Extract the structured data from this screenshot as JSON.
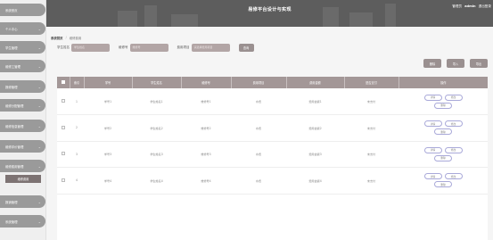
{
  "header": {
    "title": "易修平台设计与实现",
    "role": "管理员",
    "username": "admin",
    "logout": "退出登录"
  },
  "sidebar": {
    "items": [
      {
        "label": "系统首页"
      },
      {
        "label": "个人中心"
      },
      {
        "label": "学生管理"
      },
      {
        "label": "维修工管理"
      },
      {
        "label": "报修管理"
      },
      {
        "label": "维修分配管理"
      },
      {
        "label": "维修信息管理"
      },
      {
        "label": "维修评价管理"
      },
      {
        "label": "维修费用管理"
      },
      {
        "label": "报销管理"
      },
      {
        "label": "系统管理"
      }
    ],
    "active_sub": "维修费用"
  },
  "breadcrumb": {
    "home": "系统首页",
    "sep": "/",
    "current": "维修费用"
  },
  "search": {
    "fields": [
      {
        "label": "学生姓名",
        "placeholder": "学生姓名"
      },
      {
        "label": "维修号",
        "placeholder": "维修号"
      },
      {
        "label": "费用项目",
        "placeholder": "请选择费用项目"
      }
    ],
    "button": "查询"
  },
  "toolbar": {
    "delete": "删除",
    "import": "导入",
    "export": "导出"
  },
  "table": {
    "columns": [
      "",
      "索引",
      "学号",
      "学生姓名",
      "维修号",
      "费用项目",
      "费用金额",
      "是否支付",
      "操作"
    ],
    "rows": [
      {
        "index": "1",
        "student_no": "学号1",
        "name": "学生姓名1",
        "repair_no": "维修号1",
        "item": "水费",
        "amount": "费用金额1",
        "paid": "未支付"
      },
      {
        "index": "2",
        "student_no": "学号2",
        "name": "学生姓名2",
        "repair_no": "维修号2",
        "item": "水费",
        "amount": "费用金额2",
        "paid": "未支付"
      },
      {
        "index": "3",
        "student_no": "学号3",
        "name": "学生姓名3",
        "repair_no": "维修号3",
        "item": "水费",
        "amount": "费用金额3",
        "paid": "未支付"
      },
      {
        "index": "4",
        "student_no": "学号4",
        "name": "学生姓名4",
        "repair_no": "维修号4",
        "item": "水费",
        "amount": "费用金额4",
        "paid": "未支付"
      }
    ],
    "ops": {
      "detail": "详情",
      "edit": "修改",
      "delete": "删除"
    }
  },
  "colors": {
    "sidebar_item": "#9a9a9a",
    "header": "#5d5d5d",
    "table_header": "#a39797",
    "button": "#9a9090",
    "input": "#b2a5a5",
    "pill_border": "#a9a9d9"
  },
  "icons": {
    "sidebar_chevron": "chevron-down-icon",
    "checkbox": "checkbox-icon"
  }
}
